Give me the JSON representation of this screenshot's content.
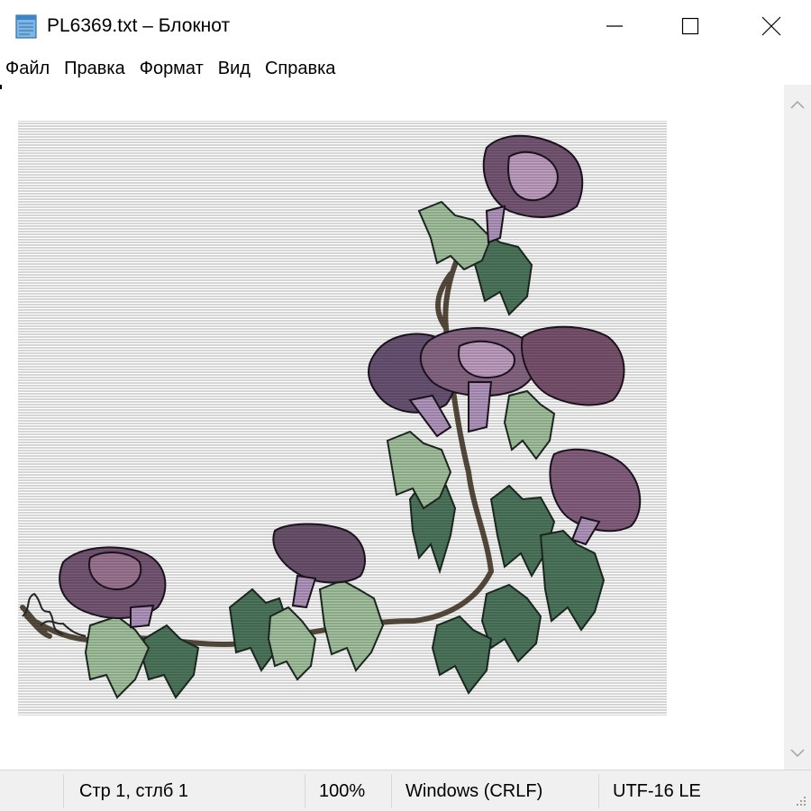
{
  "window": {
    "title": "PL6369.txt – Блокнот",
    "app_icon": "notepad-icon",
    "controls": {
      "minimize_icon": "minimize-icon",
      "maximize_icon": "maximize-icon",
      "close_icon": "close-icon"
    }
  },
  "menubar": {
    "items": [
      "Файл",
      "Правка",
      "Формат",
      "Вид",
      "Справка"
    ]
  },
  "editor": {
    "content": "ASCII-art picture: morning glory vine with purple flowers and green leaves",
    "colors": {
      "flower_purple": "#7a5a78",
      "flower_light": "#c4a3c6",
      "leaf_green": "#4f7a5f",
      "leaf_light": "#a7c8a2",
      "stem": "#5a4e3e"
    }
  },
  "scrollbar": {
    "up_icon": "chevron-up-icon",
    "down_icon": "chevron-down-icon"
  },
  "statusbar": {
    "position": "Стр 1, стлб 1",
    "zoom": "100%",
    "line_endings": "Windows (CRLF)",
    "encoding": "UTF-16 LE",
    "grip_icon": "resize-grip-icon"
  }
}
